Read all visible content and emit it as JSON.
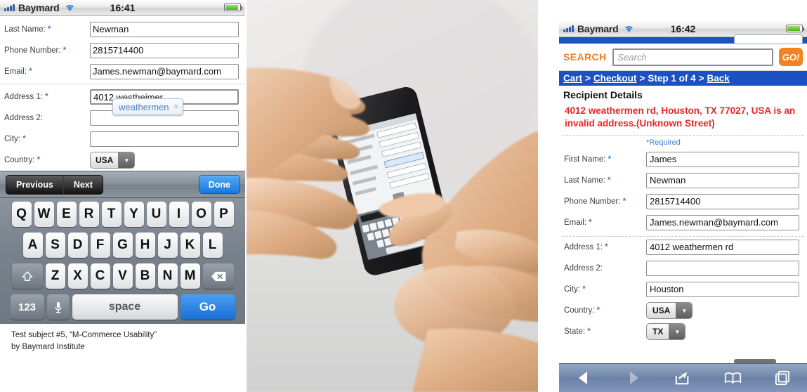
{
  "left_phone": {
    "status_bar": {
      "carrier": "Baymard",
      "time": "16:41",
      "signal_icon": "signal-bars-icon",
      "wifi_icon": "wifi-icon",
      "battery_icon": "battery-icon"
    },
    "form": {
      "fields": [
        {
          "label": "Last Name: ",
          "required": "*",
          "value": "Newman",
          "name": "last-name"
        },
        {
          "label": "Phone Number: ",
          "required": "*",
          "value": "2815714400",
          "name": "phone-number"
        },
        {
          "label": "Email: ",
          "required": "*",
          "value": "James.newman@baymard.com",
          "name": "email"
        },
        {
          "label": "Address 1: ",
          "required": "*",
          "value": "4012 westheimer",
          "name": "address-1"
        },
        {
          "label": "Address 2:",
          "required": "",
          "value": "",
          "name": "address-2"
        },
        {
          "label": "City: ",
          "required": "*",
          "value": "",
          "name": "city"
        }
      ],
      "country_label": "Country: ",
      "country_required": "*",
      "country_value": "USA"
    },
    "autocomplete": {
      "suggestion": "weathermen",
      "dismiss": "×"
    },
    "keyboard_toolbar": {
      "previous": "Previous",
      "next": "Next",
      "done": "Done"
    },
    "keyboard": {
      "row1": [
        "Q",
        "W",
        "E",
        "R",
        "T",
        "Y",
        "U",
        "I",
        "O",
        "P"
      ],
      "row2": [
        "A",
        "S",
        "D",
        "F",
        "G",
        "H",
        "J",
        "K",
        "L"
      ],
      "row3": [
        "Z",
        "X",
        "C",
        "V",
        "B",
        "N",
        "M"
      ],
      "shift": "shift-icon",
      "backspace": "backspace-icon",
      "numbers": "123",
      "mic": "microphone-icon",
      "space": "space",
      "go": "Go"
    },
    "caption_line1": "Test subject #5, “M-Commerce Usability”",
    "caption_line2": "by Baymard Institute"
  },
  "photo": {
    "alt": "Hands holding an iPhone with an on-screen keyboard, finger tapping the screen"
  },
  "right_phone": {
    "status_bar": {
      "carrier": "Baymard",
      "time": "16:42",
      "signal_icon": "signal-bars-icon",
      "wifi_icon": "wifi-icon",
      "battery_icon": "battery-icon"
    },
    "search": {
      "logo": "SEARCH",
      "placeholder": "Search",
      "value": "",
      "go": "GO!"
    },
    "breadcrumb": {
      "cart": "Cart",
      "sep1": ">",
      "checkout": "Checkout",
      "sep2": ">",
      "step": "Step 1 of 4",
      "sep3": ">",
      "back": "Back"
    },
    "section_title": "Recipient Details",
    "error": "4012 weathermen rd, Houston, TX 77027, USA is an invalid address.(Unknown Street)",
    "required_note": "*Required",
    "form": {
      "fields": [
        {
          "label": "First Name: ",
          "required": "*",
          "value": "James",
          "name": "first-name"
        },
        {
          "label": "Last Name: ",
          "required": "*",
          "value": "Newman",
          "name": "last-name"
        },
        {
          "label": "Phone Number: ",
          "required": "*",
          "value": "2815714400",
          "name": "phone-number"
        },
        {
          "label": "Email: ",
          "required": "*",
          "value": "James.newman@baymard.com",
          "name": "email"
        }
      ],
      "fields2": [
        {
          "label": "Address 1: ",
          "required": "*",
          "value": "4012 weathermen rd",
          "name": "address-1"
        },
        {
          "label": "Address 2:",
          "required": "",
          "value": "",
          "name": "address-2"
        },
        {
          "label": "City: ",
          "required": "*",
          "value": "Houston",
          "name": "city"
        }
      ],
      "country_label": "Country: ",
      "country_required": "*",
      "country_value": "USA",
      "state_label": "State: ",
      "state_required": "*",
      "state_value": "TX"
    },
    "safari_toolbar": {
      "back": "back-arrow-icon",
      "forward": "forward-arrow-icon",
      "share": "share-icon",
      "bookmarks": "bookmarks-icon",
      "tabs": "tabs-icon"
    }
  },
  "colors": {
    "accent_blue": "#1a52c4",
    "link_blue": "#3d7fd0",
    "error_red": "#e8262a",
    "orange": "#f08322",
    "done_blue": "#1878e0"
  }
}
